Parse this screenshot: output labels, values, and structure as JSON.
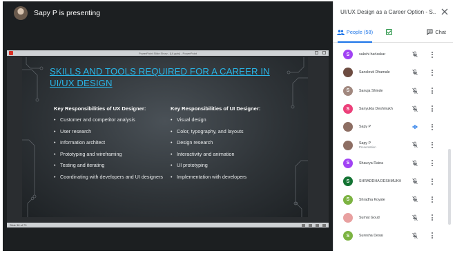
{
  "presenter": {
    "label": "Sapy P is presenting"
  },
  "shared_window": {
    "title": "PowerPoint Slide Show - [UI.pptx] - PowerPoint",
    "slide_counter": "Slide 38 of 73"
  },
  "slide": {
    "title": "SKILLS AND TOOLS REQUIRED FOR A CAREER IN UI/UX DESIGN",
    "ux_heading": "Key Responsibilities of UX Designer:",
    "ux_items": [
      "Customer and competitor analysis",
      "User research",
      "Information architect",
      "Prototyping and wireframing",
      "Testing and iterating",
      "Coordinating with developers and UI designers"
    ],
    "ui_heading": "Key Responsibilities of UI Designer:",
    "ui_items": [
      "Visual design",
      "Color, typography, and layouts",
      "Design research",
      "Interactivity and animation",
      "UI prototyping",
      "Implementation with developers"
    ],
    "title_color": "#29b6e8"
  },
  "panel": {
    "meeting_title": "UI/UX Design as a Career Option - S...",
    "tab_people_label": "People (58)",
    "tab_chat_label": "Chat",
    "accent_color": "#1a73e8"
  },
  "people": [
    {
      "name": "sakshi harlaskar",
      "role": "",
      "initial": "S",
      "avatar_color": "#a142f4",
      "mic": "muted"
    },
    {
      "name": "Sanskruti Dhamale",
      "role": "",
      "initial": "",
      "avatar_color": "#6d4c41",
      "mic": "muted"
    },
    {
      "name": "Sanuja Shinde",
      "role": "",
      "initial": "S",
      "avatar_color": "#a1887f",
      "mic": "muted"
    },
    {
      "name": "Sanyukta Deshmukh",
      "role": "",
      "initial": "S",
      "avatar_color": "#ec407a",
      "mic": "muted"
    },
    {
      "name": "Sapy P",
      "role": "",
      "initial": "",
      "avatar_color": "#8d6e63",
      "mic": "speaking"
    },
    {
      "name": "Sapy P",
      "role": "Presentation",
      "initial": "",
      "avatar_color": "#8d6e63",
      "mic": "muted"
    },
    {
      "name": "Shaurya Raina",
      "role": "",
      "initial": "S",
      "avatar_color": "#a142f4",
      "mic": "muted"
    },
    {
      "name": "SHRADDHA DESHMUKH",
      "role": "",
      "initial": "S",
      "avatar_color": "#137333",
      "mic": "muted"
    },
    {
      "name": "Shradha Koyale",
      "role": "",
      "initial": "S",
      "avatar_color": "#7cb342",
      "mic": "muted"
    },
    {
      "name": "Sumat Goud",
      "role": "",
      "initial": "",
      "avatar_color": "#e8a0a0",
      "mic": "muted"
    },
    {
      "name": "Suresha Desai",
      "role": "",
      "initial": "S",
      "avatar_color": "#7cb342",
      "mic": "muted"
    }
  ]
}
